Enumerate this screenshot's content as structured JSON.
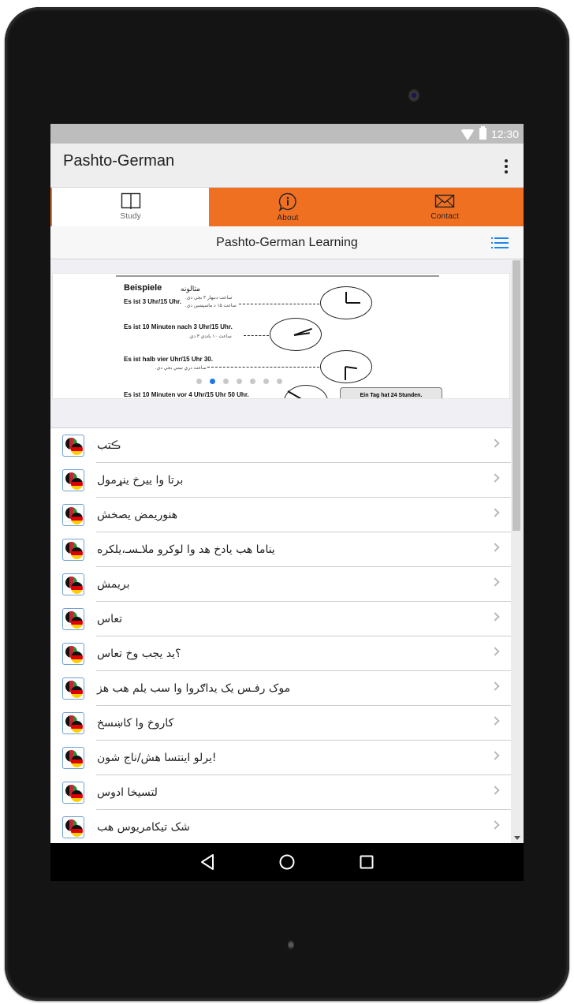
{
  "status_bar": {
    "time": "12:30",
    "icons": [
      "wifi-icon",
      "battery-icon"
    ]
  },
  "action_bar": {
    "title": "Pashto-German",
    "overflow_icon": "more-vert-icon"
  },
  "tabs": [
    {
      "label": "Study",
      "icon": "book-icon",
      "active": true
    },
    {
      "label": "About",
      "icon": "info-bubble-icon",
      "active": false
    },
    {
      "label": "Contact",
      "icon": "envelope-icon",
      "active": false
    }
  ],
  "sub_header": {
    "title": "Pashto-German Learning",
    "menu_icon": "list-icon"
  },
  "carousel": {
    "slide_count": 7,
    "active_index": 1,
    "slide": {
      "heading": "Beispiele",
      "heading_ps": "مثالونه",
      "lines": [
        {
          "de": "Es ist 3 Uhr/15 Uhr.",
          "ps": [
            "ساعت دىيهار ۳ بجي دي.",
            "ساعت ۱۵ د ماسپښين دي."
          ]
        },
        {
          "de": "Es ist 10 Minuten nach 3 Uhr/15 Uhr.",
          "ps": [
            "ساعت ۱۰ باندي ۳ دي."
          ]
        },
        {
          "de": "Es ist halb vier Uhr/15 Uhr 30.",
          "ps": [
            "ساعت دري نيمي بجي دي."
          ]
        },
        {
          "de": "Es ist 10 Minuten vor 4 Uhr/15 Uhr 50 Uhr.",
          "ps": []
        }
      ],
      "note": "Ein Tag hat 24 Stunden."
    }
  },
  "list": {
    "items": [
      {
        "label": "ڪتب",
        "icon": "af-de-flag-icon"
      },
      {
        "label": "برتا وا ييرخ ينړمول",
        "icon": "af-de-flag-icon"
      },
      {
        "label": "هنوريمض يصخش",
        "icon": "af-de-flag-icon"
      },
      {
        "label": "يناما هب يادخ هد وا لوکرو ملاـسـ،يلکره",
        "icon": "af-de-flag-icon"
      },
      {
        "label": "بريمش",
        "icon": "af-de-flag-icon"
      },
      {
        "label": "تعاس",
        "icon": "af-de-flag-icon"
      },
      {
        "label": "؟يد يجب وخ تعاس",
        "icon": "af-de-flag-icon"
      },
      {
        "label": "موک رفـس يک يداګروا وا سب يلم هب هز",
        "icon": "af-de-flag-icon"
      },
      {
        "label": "کاروخ وا کاښسخ",
        "icon": "af-de-flag-icon"
      },
      {
        "label": "!يرلو اينتسا هش/ناج شون",
        "icon": "af-de-flag-icon"
      },
      {
        "label": "لتسيخا ادوس",
        "icon": "af-de-flag-icon"
      },
      {
        "label": "شک تيکامريوس هب",
        "icon": "af-de-flag-icon"
      }
    ]
  },
  "nav_bar": {
    "buttons": [
      "back-icon",
      "home-icon",
      "recents-icon"
    ]
  },
  "colors": {
    "accent": "#f07022",
    "active_dot": "#1e7ae0",
    "list_icon": "#1e88e5"
  }
}
